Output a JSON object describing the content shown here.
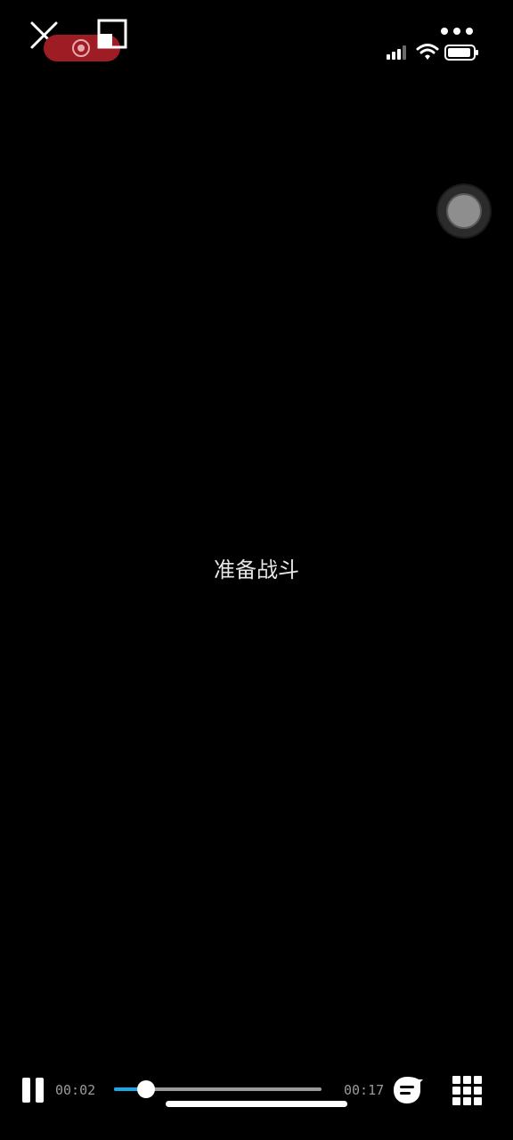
{
  "top_bar": {
    "close_icon": "close-icon",
    "record_icon": "screen-record-icon",
    "pip_icon": "picture-in-picture-icon",
    "more_icon": "more-dots-icon",
    "record_color": "#9e1c24"
  },
  "status_bar": {
    "signal_icon": "cellular-signal-icon",
    "wifi_icon": "wifi-icon",
    "battery_icon": "battery-icon"
  },
  "floating_button": {
    "icon": "assistive-touch-icon"
  },
  "video": {
    "caption": "准备战斗"
  },
  "player": {
    "state_icon": "pause-icon",
    "current_time": "00:02",
    "total_time": "00:17",
    "progress": 0.155,
    "progress_color": "#1aa8e8",
    "subtitle_icon": "subtitle-icon",
    "grid_icon": "grid-menu-icon"
  }
}
